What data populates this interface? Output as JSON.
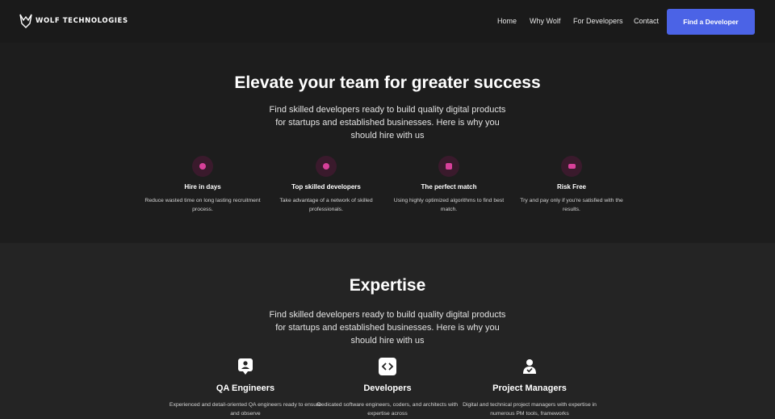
{
  "header": {
    "brand": "WOLF TECHNOLOGIES",
    "nav": [
      {
        "label": "Home"
      },
      {
        "label": "Why Wolf"
      },
      {
        "label": "For Developers"
      },
      {
        "label": "Contact"
      }
    ],
    "cta_label": "Find a Developer"
  },
  "colors": {
    "accent": "#4b63e6",
    "feature_icon": "#d8409a",
    "background": "#1d1d1d"
  },
  "hero": {
    "title": "Elevate your team for greater success",
    "lead": "Find skilled developers ready to build quality digital products for startups and established businesses. Here is why you should hire with us",
    "features": [
      {
        "icon": "clock-icon",
        "title": "Hire in days",
        "desc": "Reduce wasted time on long lasting recruitment process."
      },
      {
        "icon": "developer-icon",
        "title": "Top skilled developers",
        "desc": "Take advantage of a network of skilled professionals."
      },
      {
        "icon": "match-icon",
        "title": "The perfect match",
        "desc": "Using highly optimized algorithms to find best match."
      },
      {
        "icon": "ticket-icon",
        "title": "Risk Free",
        "desc": "Try and pay only if you're satisfied with the results."
      }
    ]
  },
  "expertise": {
    "title": "Expertise",
    "lead": "Find skilled developers ready to build quality digital products for startups and established businesses. Here is why you should hire with us",
    "items": [
      {
        "icon": "badge-icon",
        "title": "QA Engineers",
        "desc": "Experienced and detail-oriented QA engineers ready to ensure and observe"
      },
      {
        "icon": "code-icon",
        "title": "Developers",
        "desc": "Dedicated software engineers, coders, and architects with expertise across"
      },
      {
        "icon": "manager-icon",
        "title": "Project Managers",
        "desc": "Digital and technical project managers with expertise in numerous PM tools, frameworks"
      }
    ]
  }
}
